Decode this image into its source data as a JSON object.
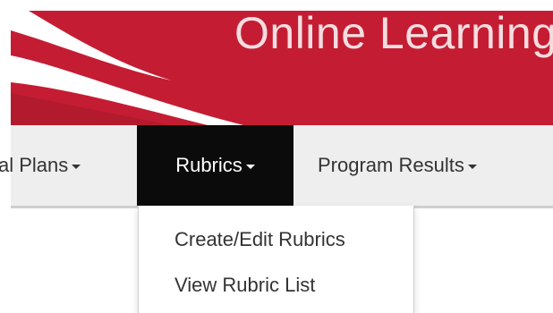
{
  "banner": {
    "title": "Online Learning"
  },
  "nav": {
    "items": [
      {
        "label": "al Plans"
      },
      {
        "label": "Rubrics"
      },
      {
        "label": "Program Results"
      }
    ]
  },
  "dropdown": {
    "items": [
      {
        "label": "Create/Edit Rubrics"
      },
      {
        "label": "View Rubric List"
      }
    ]
  },
  "colors": {
    "banner_red": "#c41d33",
    "nav_bg": "#eeeeee",
    "active_bg": "#0b0b0b"
  }
}
